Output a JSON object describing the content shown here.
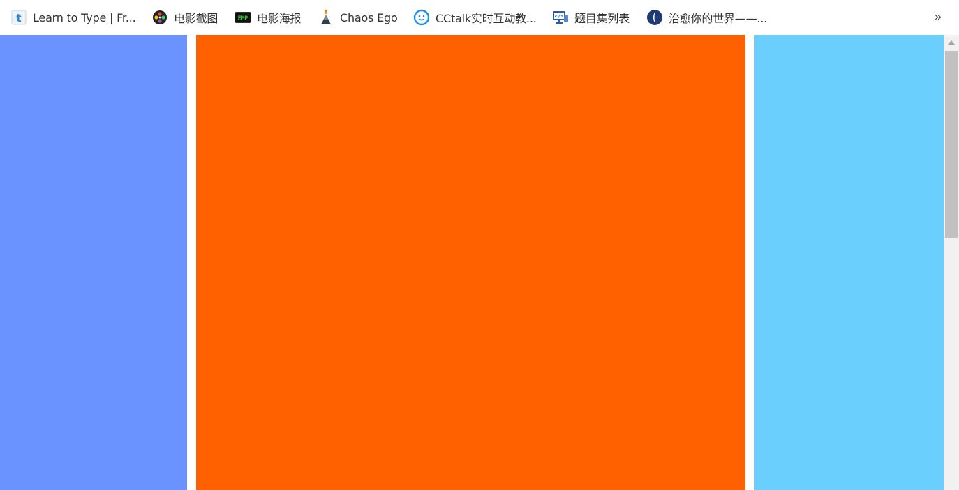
{
  "bookmarks": [
    {
      "label": "Learn to Type | Fr...",
      "icon": "typing-t-icon",
      "color": "#2b87d1"
    },
    {
      "label": "电影截图",
      "icon": "film-reel-icon",
      "color": "#c0392b"
    },
    {
      "label": "电影海报",
      "icon": "emp-terminal-icon",
      "color": "#1a1a1a"
    },
    {
      "label": "Chaos Ego",
      "icon": "chaos-ego-icon",
      "color": "#2c3e50"
    },
    {
      "label": "CCtalk实时互动教...",
      "icon": "cctalk-face-icon",
      "color": "#1e90e6"
    },
    {
      "label": "题目集列表",
      "icon": "code-monitor-icon",
      "color": "#2a5caa"
    },
    {
      "label": "治愈你的世界——...",
      "icon": "moon-logo-icon",
      "color": "#1f3a6e"
    }
  ],
  "overflow_chevron": "»",
  "columns": {
    "left_color": "#6a93ff",
    "middle_color": "#ff6000",
    "right_color": "#6bcffe"
  },
  "scrollbar": {
    "position_fraction": 0.0
  }
}
